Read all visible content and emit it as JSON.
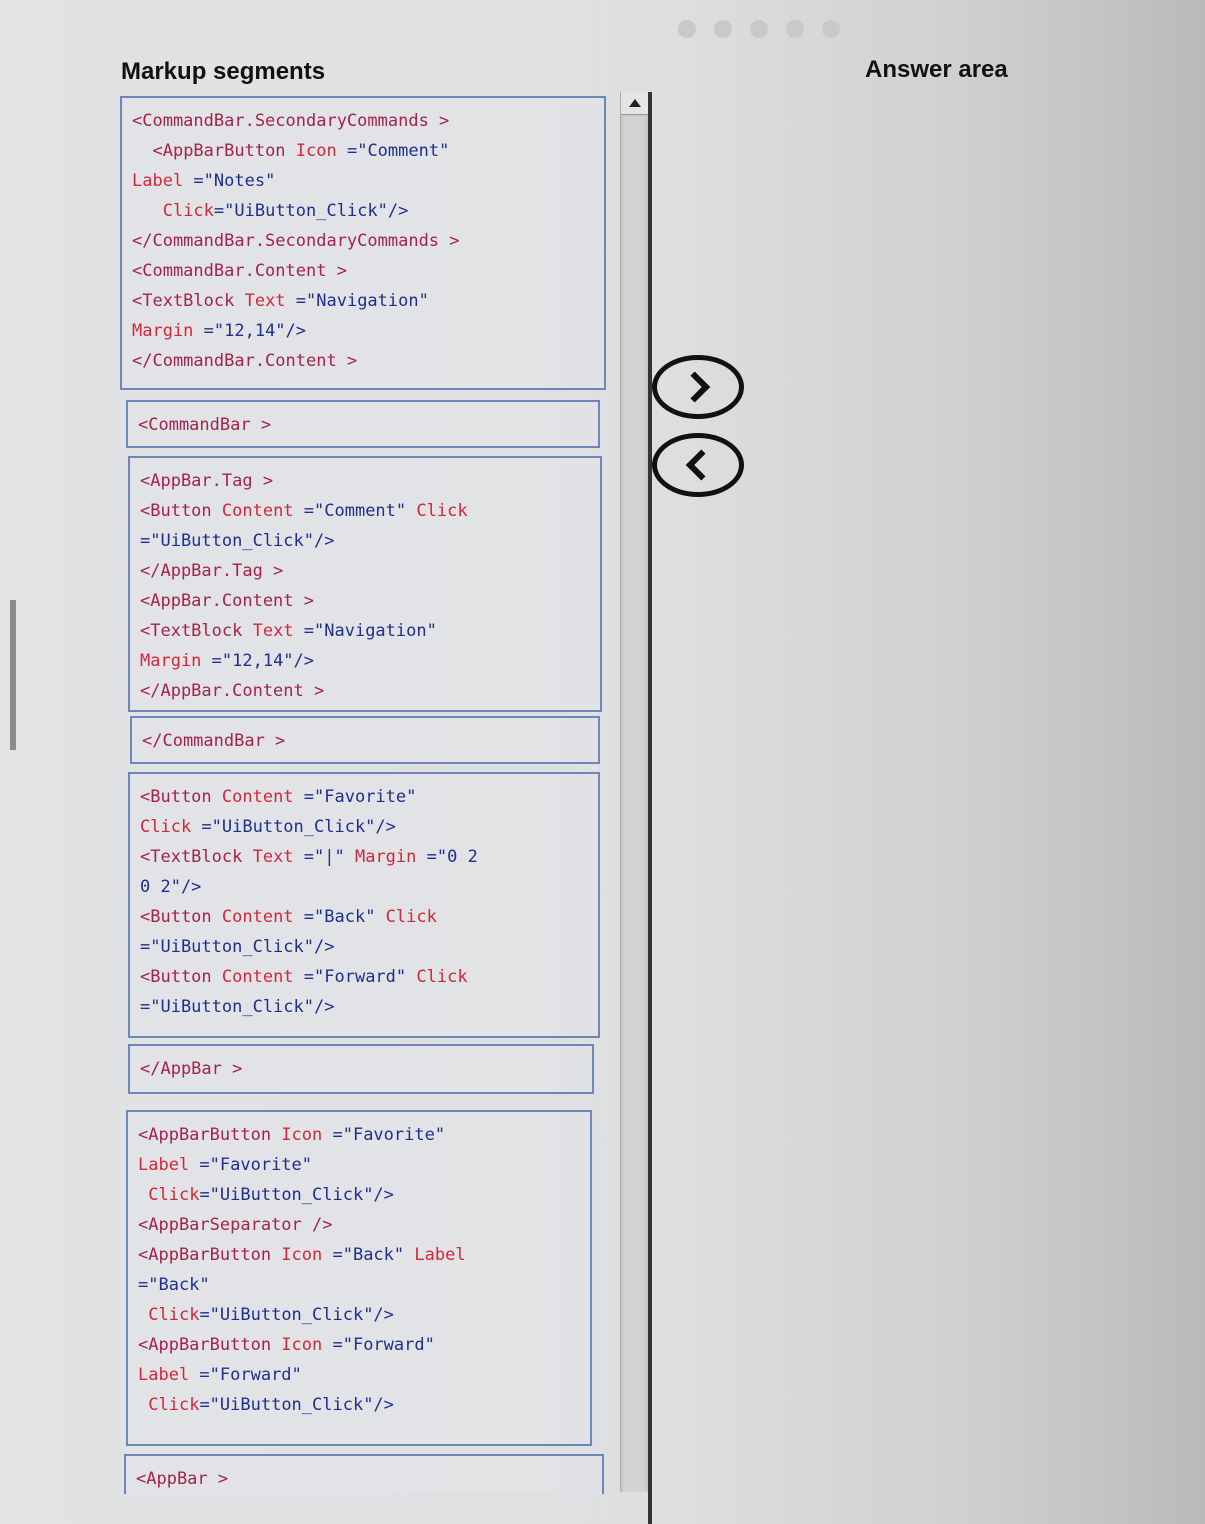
{
  "pager": {
    "dots": 5
  },
  "titles": {
    "segments": "Markup segments",
    "answer": "Answer area"
  },
  "segments": [
    {
      "lines": [
        [
          [
            "tag",
            "<CommandBar.SecondaryCommands >"
          ]
        ],
        [
          [
            "tag",
            "  <AppBarButton "
          ],
          [
            "attr",
            "Icon "
          ],
          [
            "val",
            "=\"Comment\""
          ]
        ],
        [
          [
            "attr",
            "Label "
          ],
          [
            "val",
            "=\"Notes\""
          ]
        ],
        [
          [
            "attr",
            "   Click"
          ],
          [
            "val",
            "=\"UiButton_Click\"/>"
          ]
        ],
        [
          [
            "tag",
            "</CommandBar.SecondaryCommands >"
          ]
        ],
        [
          [
            "tag",
            "<CommandBar.Content >"
          ]
        ],
        [
          [
            "tag",
            "<TextBlock "
          ],
          [
            "attr",
            "Text "
          ],
          [
            "val",
            "=\"Navigation\""
          ]
        ],
        [
          [
            "attr",
            "Margin "
          ],
          [
            "val",
            "=\"12,14\"/>"
          ]
        ],
        [
          [
            "tag",
            "</CommandBar.Content >"
          ]
        ]
      ]
    },
    {
      "lines": [
        [
          [
            "tag",
            "<CommandBar >"
          ]
        ]
      ]
    },
    {
      "lines": [
        [
          [
            "tag",
            "<AppBar.Tag >"
          ]
        ],
        [
          [
            "tag",
            "<Button "
          ],
          [
            "attr",
            "Content "
          ],
          [
            "val",
            "=\"Comment\" "
          ],
          [
            "attr",
            "Click"
          ]
        ],
        [
          [
            "val",
            "=\"UiButton_Click\"/>"
          ]
        ],
        [
          [
            "tag",
            "</AppBar.Tag >"
          ]
        ],
        [
          [
            "tag",
            "<AppBar.Content >"
          ]
        ],
        [
          [
            "tag",
            "<TextBlock "
          ],
          [
            "attr",
            "Text "
          ],
          [
            "val",
            "=\"Navigation\""
          ]
        ],
        [
          [
            "attr",
            "Margin "
          ],
          [
            "val",
            "=\"12,14\"/>"
          ]
        ],
        [
          [
            "tag",
            "</AppBar.Content >"
          ]
        ]
      ]
    },
    {
      "lines": [
        [
          [
            "tag",
            "</CommandBar >"
          ]
        ]
      ]
    },
    {
      "lines": [
        [
          [
            "tag",
            "<Button "
          ],
          [
            "attr",
            "Content "
          ],
          [
            "val",
            "=\"Favorite\""
          ]
        ],
        [
          [
            "attr",
            "Click "
          ],
          [
            "val",
            "=\"UiButton_Click\"/>"
          ]
        ],
        [
          [
            "tag",
            "<TextBlock "
          ],
          [
            "attr",
            "Text "
          ],
          [
            "val",
            "=\"|\" "
          ],
          [
            "attr",
            "Margin "
          ],
          [
            "val",
            "=\"0 2"
          ]
        ],
        [
          [
            "val",
            "0 2\"/>"
          ]
        ],
        [
          [
            "tag",
            "<Button "
          ],
          [
            "attr",
            "Content "
          ],
          [
            "val",
            "=\"Back\" "
          ],
          [
            "attr",
            "Click"
          ]
        ],
        [
          [
            "val",
            "=\"UiButton_Click\"/>"
          ]
        ],
        [
          [
            "tag",
            "<Button "
          ],
          [
            "attr",
            "Content "
          ],
          [
            "val",
            "=\"Forward\" "
          ],
          [
            "attr",
            "Click"
          ]
        ],
        [
          [
            "val",
            "=\"UiButton_Click\"/>"
          ]
        ]
      ]
    },
    {
      "lines": [
        [
          [
            "tag",
            "</AppBar >"
          ]
        ]
      ]
    },
    {
      "lines": [
        [
          [
            "tag",
            "<AppBarButton "
          ],
          [
            "attr",
            "Icon "
          ],
          [
            "val",
            "=\"Favorite\""
          ]
        ],
        [
          [
            "attr",
            "Label "
          ],
          [
            "val",
            "=\"Favorite\""
          ]
        ],
        [
          [
            "attr",
            " Click"
          ],
          [
            "val",
            "=\"UiButton_Click\"/>"
          ]
        ],
        [
          [
            "tag",
            "<AppBarSeparator />"
          ]
        ],
        [
          [
            "tag",
            "<AppBarButton "
          ],
          [
            "attr",
            "Icon "
          ],
          [
            "val",
            "=\"Back\" "
          ],
          [
            "attr",
            "Label"
          ]
        ],
        [
          [
            "val",
            "=\"Back\""
          ]
        ],
        [
          [
            "attr",
            " Click"
          ],
          [
            "val",
            "=\"UiButton_Click\"/>"
          ]
        ],
        [
          [
            "tag",
            "<AppBarButton "
          ],
          [
            "attr",
            "Icon "
          ],
          [
            "val",
            "=\"Forward\""
          ]
        ],
        [
          [
            "attr",
            "Label "
          ],
          [
            "val",
            "=\"Forward\""
          ]
        ],
        [
          [
            "attr",
            " Click"
          ],
          [
            "val",
            "=\"UiButton_Click\"/>"
          ]
        ]
      ]
    },
    {
      "lines": [
        [
          [
            "tag",
            "<AppBar >"
          ]
        ]
      ]
    }
  ],
  "controls": {
    "move_right": "move-right",
    "move_left": "move-left"
  },
  "answer_items": []
}
